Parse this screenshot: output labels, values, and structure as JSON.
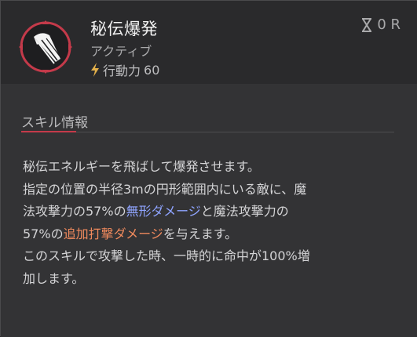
{
  "skill": {
    "name": "秘伝爆発",
    "type": "アクティブ",
    "ap_label": "行動力",
    "ap_value": "60",
    "cooldown": "0 R"
  },
  "section": {
    "title": "スキル情報"
  },
  "description": {
    "line1": "秘伝エネルギーを飛ばして爆発させます。",
    "line2": "指定の位置の半径3mの円形範囲内にいる敵に、魔",
    "line3_a": "法攻撃力の57%の",
    "line3_b": "無形ダメージ",
    "line3_c": "と魔法攻撃力の",
    "line4_a": "57%の",
    "line4_b": "追加打撃ダメージ",
    "line4_c": "を与えます。",
    "line5": "このスキルで攻撃した時、一時的に命中が100%増",
    "line6": "加します。"
  },
  "colors": {
    "accent_red": "#c43a4a",
    "magic_blue": "#8fa4ff",
    "extra_orange": "#f08a5d",
    "ap_gold": "#e3b04a"
  },
  "icons": [
    "skill-comet-icon",
    "hourglass-icon",
    "lightning-bolt-icon"
  ]
}
